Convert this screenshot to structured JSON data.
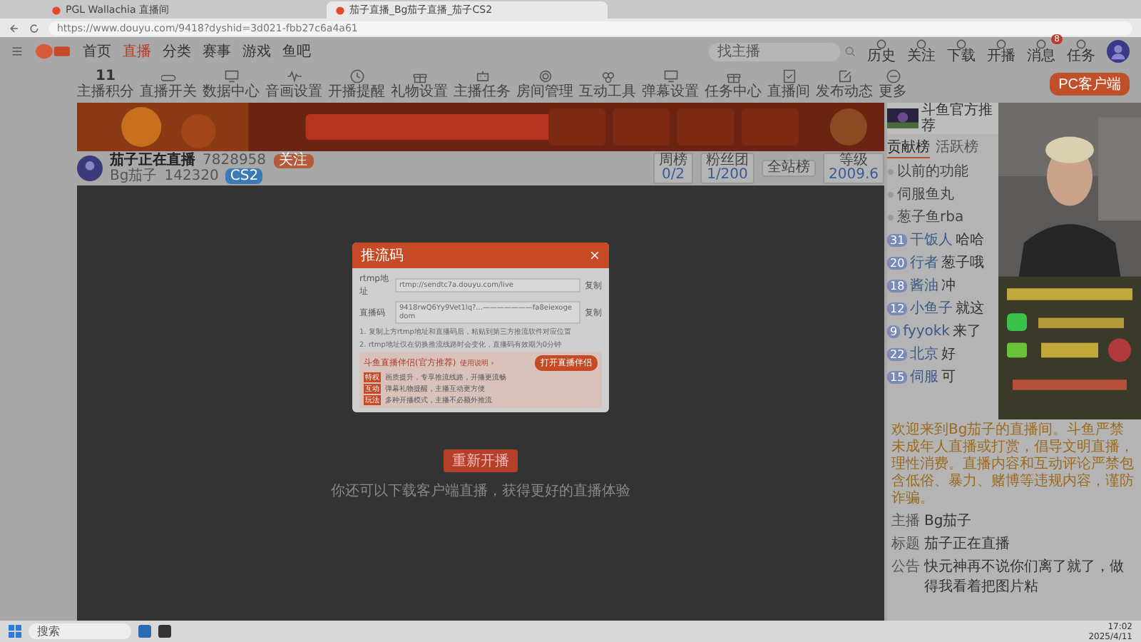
{
  "browser": {
    "tabs": [
      {
        "title": "PGL Wallachia 直播间",
        "selected": false
      },
      {
        "title": "茄子直播_Bg茄子直播_茄子CS2",
        "selected": true
      }
    ],
    "url": "https://www.douyu.com/9418?dyshid=3d021-fbb27c6a4a61"
  },
  "nav": {
    "items": [
      {
        "label": "首页",
        "selected": false
      },
      {
        "label": "直播",
        "selected": true
      },
      {
        "label": "分类",
        "selected": false
      },
      {
        "label": "赛事",
        "selected": false
      },
      {
        "label": "游戏",
        "selected": false
      },
      {
        "label": "鱼吧",
        "selected": false
      }
    ],
    "search_placeholder": "找主播",
    "user_items": [
      {
        "label": "历史"
      },
      {
        "label": "关注"
      },
      {
        "label": "下载"
      },
      {
        "label": "开播"
      },
      {
        "label": "消息",
        "badge": "8"
      },
      {
        "label": "任务"
      }
    ]
  },
  "tools": {
    "date": "11",
    "date_label": "主播积分",
    "items": [
      {
        "label": "直播开关",
        "kind": "toggle"
      },
      {
        "label": "数据中心",
        "kind": "screen"
      },
      {
        "label": "音画设置",
        "kind": "wave"
      },
      {
        "label": "开播提醒",
        "kind": "clock"
      },
      {
        "label": "礼物设置",
        "kind": "gift"
      },
      {
        "label": "主播任务",
        "kind": "robot"
      },
      {
        "label": "房间管理",
        "kind": "gear"
      },
      {
        "label": "互动工具",
        "kind": "circles"
      },
      {
        "label": "弹幕设置",
        "kind": "screen"
      },
      {
        "label": "任务中心",
        "kind": "gift"
      },
      {
        "label": "直播间",
        "kind": "check"
      },
      {
        "label": "发布动态",
        "kind": "edit"
      },
      {
        "label": "更多",
        "kind": "more"
      }
    ],
    "pc_button": "PC客户端"
  },
  "header": {
    "name": "茄子正在直播",
    "room": "7828958",
    "follow": "关注",
    "host": "Bg茄子",
    "views": "142320",
    "category": "CS2",
    "stats": [
      {
        "label": "周榜",
        "value": "0/2"
      },
      {
        "label": "粉丝团",
        "value": "1/200"
      },
      {
        "label": "全站榜"
      },
      {
        "label": "等级",
        "value": "2009.6"
      }
    ]
  },
  "modal": {
    "title": "推流码",
    "fields": [
      {
        "label": "rtmp地址",
        "value": "rtmp://sendtc7a.douyu.com/live",
        "copy": "复制"
      },
      {
        "label": "直播码",
        "value": "9418rwQ6Yy9Vet1lq?...———————fa8eiexogedom",
        "copy": "复制"
      }
    ],
    "notes": [
      "1. 复制上方rtmp地址和直播码后，粘贴到第三方推流软件对应位置",
      "2. rtmp地址仅在切换推流线路时会变化，直播码有效期为0分钟"
    ],
    "promo": {
      "title": "斗鱼直播伴侣(官方推荐)",
      "link": "使用说明 ›",
      "button": "打开直播伴侣",
      "rows": [
        {
          "tag": "特权",
          "text": "画质提升，专享推流线路，开播更流畅"
        },
        {
          "tag": "互动",
          "text": "弹幕礼物提醒，主播互动更方便"
        },
        {
          "tag": "玩法",
          "text": "多种开播模式，主播不必额外推流"
        }
      ]
    }
  },
  "video": {
    "button": "重新开播",
    "hint": "你还可以下载客户端直播，获得更好的直播体验"
  },
  "chat": {
    "promo_title": "斗鱼官方推荐",
    "tabs": [
      {
        "label": "贡献榜",
        "selected": true
      },
      {
        "label": "活跃榜",
        "selected": false
      }
    ],
    "pinned": [
      "以前的功能",
      "伺服鱼丸",
      "葱子鱼rba"
    ],
    "messages": [
      {
        "level": "31",
        "name": "干饭人",
        "text": "哈哈"
      },
      {
        "level": "20",
        "name": "行者",
        "text": "葱子哦"
      },
      {
        "level": "18",
        "name": "酱油",
        "text": "冲"
      },
      {
        "level": "12",
        "name": "小鱼子",
        "text": "就这"
      },
      {
        "level": "9",
        "name": "fyyokk",
        "text": "来了"
      },
      {
        "level": "22",
        "name": "北京",
        "text": "好"
      },
      {
        "level": "15",
        "name": "伺服",
        "text": "可"
      }
    ],
    "notice": "欢迎来到Bg茄子的直播间。斗鱼严禁未成年人直播或打赏，倡导文明直播，理性消费。直播内容和互动评论严禁包含低俗、暴力、赌博等违规内容，谨防诈骗。",
    "info": [
      {
        "label": "主播",
        "text": "Bg茄子"
      },
      {
        "label": "标题",
        "text": "茄子正在直播"
      },
      {
        "label": "公告",
        "text": "快元神再不说你们离了就了，做得我看着把图片粘"
      }
    ]
  },
  "taskbar": {
    "search": "搜索",
    "time": "17:02",
    "date": "2025/4/11"
  }
}
